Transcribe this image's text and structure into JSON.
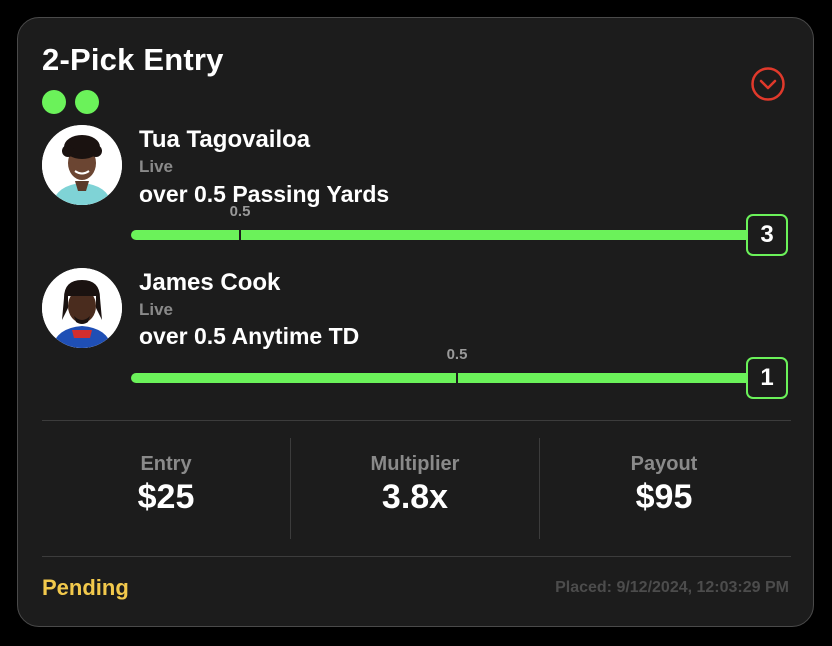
{
  "entry": {
    "title": "2-Pick Entry",
    "pick_dot_color": "#6bf25a",
    "toggle_icon": "chevron-down-circle-icon",
    "toggle_color": "#e0392b"
  },
  "picks": [
    {
      "name": "Tua Tagovailoa",
      "status": "Live",
      "line": "over 0.5 Passing Yards",
      "threshold_label": "0.5",
      "current_value": "3",
      "avatar_icon": "player-headshot"
    },
    {
      "name": "James Cook",
      "status": "Live",
      "line": "over 0.5 Anytime TD",
      "threshold_label": "0.5",
      "current_value": "1",
      "avatar_icon": "player-headshot"
    }
  ],
  "summary": {
    "entry_label": "Entry",
    "entry_value": "$25",
    "multiplier_label": "Multiplier",
    "multiplier_value": "3.8x",
    "payout_label": "Payout",
    "payout_value": "$95"
  },
  "footer": {
    "status": "Pending",
    "placed": "Placed: 9/12/2024, 12:03:29 PM",
    "status_color": "#f2c94c"
  }
}
